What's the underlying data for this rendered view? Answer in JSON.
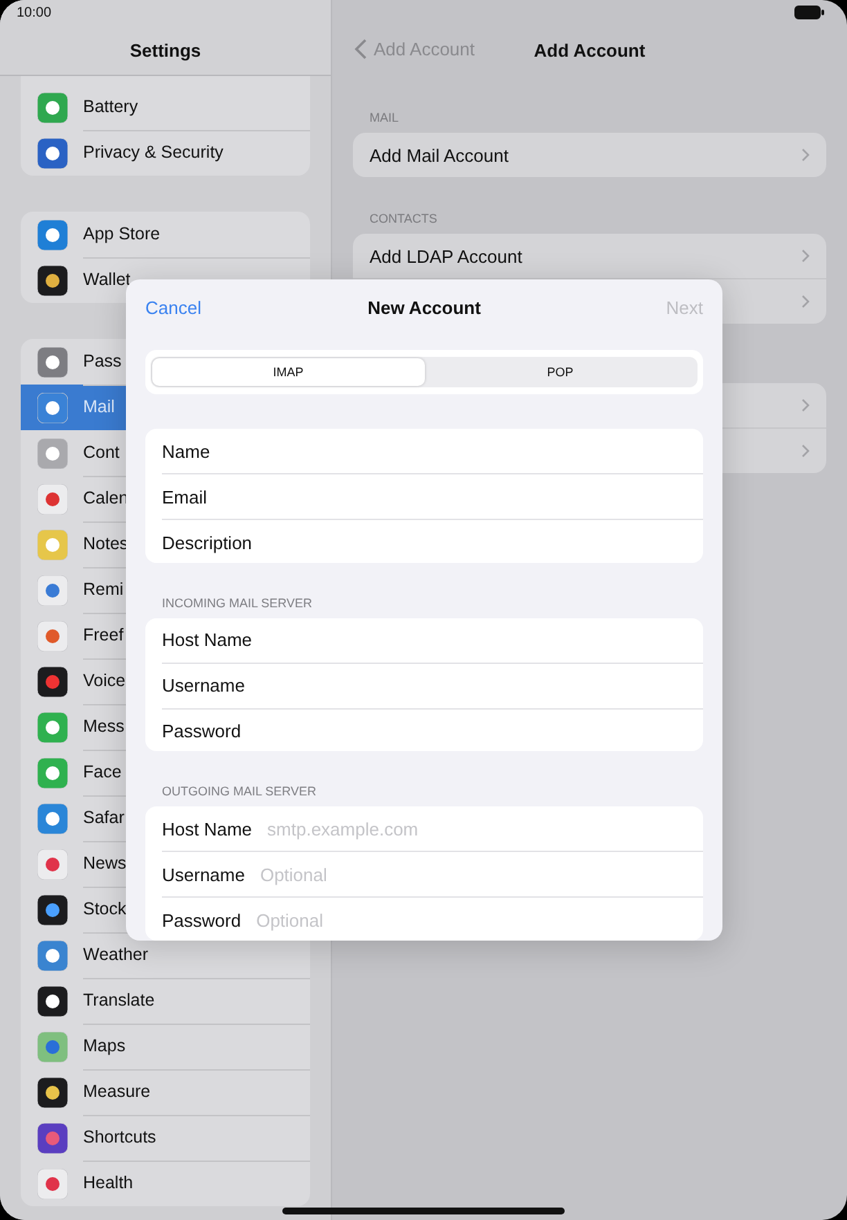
{
  "status_bar": {
    "time": "10:00"
  },
  "sidebar": {
    "title": "Settings",
    "groups": [
      {
        "items": [
          {
            "label": "Battery",
            "selected": false
          },
          {
            "label": "Privacy & Security",
            "selected": false
          }
        ]
      },
      {
        "items": [
          {
            "label": "App Store",
            "selected": false
          },
          {
            "label": "Wallet",
            "selected": false
          }
        ]
      },
      {
        "items": [
          {
            "label": "Pass",
            "selected": false
          },
          {
            "label": "Mail",
            "selected": true
          },
          {
            "label": "Cont",
            "selected": false
          },
          {
            "label": "Calen",
            "selected": false
          },
          {
            "label": "Notes",
            "selected": false
          },
          {
            "label": "Remi",
            "selected": false
          },
          {
            "label": "Freef",
            "selected": false
          },
          {
            "label": "Voice",
            "selected": false
          },
          {
            "label": "Mess",
            "selected": false
          },
          {
            "label": "Face",
            "selected": false
          },
          {
            "label": "Safar",
            "selected": false
          },
          {
            "label": "News",
            "selected": false
          },
          {
            "label": "Stock",
            "selected": false
          },
          {
            "label": "Weather",
            "selected": false
          },
          {
            "label": "Translate",
            "selected": false
          },
          {
            "label": "Maps",
            "selected": false
          },
          {
            "label": "Measure",
            "selected": false
          },
          {
            "label": "Shortcuts",
            "selected": false
          },
          {
            "label": "Health",
            "selected": false
          }
        ]
      }
    ]
  },
  "detail": {
    "back": "Add Account",
    "title": "Add Account",
    "sections": [
      {
        "header": "MAIL",
        "rows": [
          {
            "label": "Add Mail Account"
          }
        ]
      },
      {
        "header": "CONTACTS",
        "rows": [
          {
            "label": "Add LDAP Account"
          },
          {}
        ]
      },
      {
        "rows": [
          {},
          {}
        ]
      }
    ]
  },
  "dialog": {
    "cancel": "Cancel",
    "title": "New Account",
    "next": {
      "label": "Next",
      "disabled": true
    },
    "segments": [
      {
        "label": "IMAP",
        "selected": true
      },
      {
        "label": "POP",
        "selected": false
      }
    ],
    "sections": [
      {
        "fields": [
          {
            "label": "Name"
          },
          {
            "label": "Email"
          },
          {
            "label": "Description"
          }
        ]
      },
      {
        "header": "INCOMING MAIL SERVER",
        "fields": [
          {
            "label": "Host Name"
          },
          {
            "label": "Username"
          },
          {
            "label": "Password"
          }
        ]
      },
      {
        "header": "OUTGOING MAIL SERVER",
        "fields": [
          {
            "label": "Host Name",
            "placeholder": "smtp.example.com"
          },
          {
            "label": "Username",
            "placeholder": "Optional"
          },
          {
            "label": "Password",
            "placeholder": "Optional"
          }
        ]
      }
    ]
  }
}
